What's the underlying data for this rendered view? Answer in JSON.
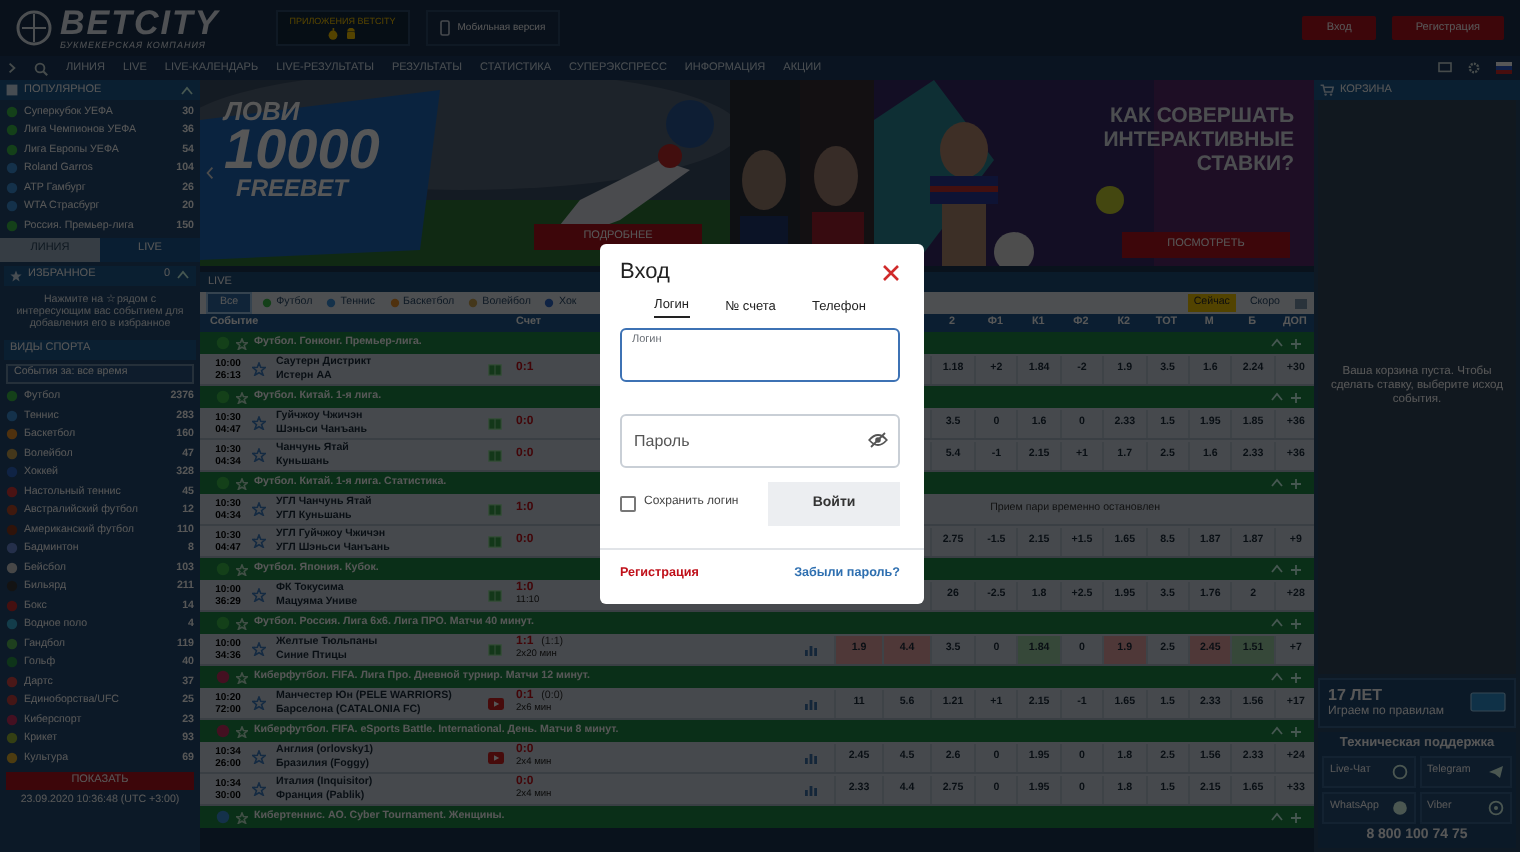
{
  "header": {
    "logo": "BETCITY",
    "logo_tagline": "БУКМЕКЕРСКАЯ КОМПАНИЯ",
    "apps_label": "ПРИЛОЖЕНИЯ BETCITY",
    "mobile_label": "Мобильная версия",
    "buttons": [
      "Вход",
      "Регистрация"
    ]
  },
  "nav": {
    "items": [
      "ЛИНИЯ",
      "LIVE",
      "LIVE-КАЛЕНДАРЬ",
      "LIVE-РЕЗУЛЬТАТЫ",
      "РЕЗУЛЬТАТЫ",
      "СТАТИСТИКА",
      "СУПЕРЭКСПРЕСС",
      "ИНФОРМАЦИЯ",
      "АКЦИИ"
    ]
  },
  "left_sidebar": {
    "popular": {
      "title": "ПОПУЛЯРНОЕ",
      "items": [
        {
          "name": "Суперкубок УЕФА",
          "count": "30",
          "kind": "football"
        },
        {
          "name": "Лига Чемпионов УЕФА",
          "count": "36",
          "kind": "football"
        },
        {
          "name": "Лига Европы УЕФА",
          "count": "54",
          "kind": "football"
        },
        {
          "name": "Roland Garros",
          "count": "104",
          "kind": "tennis"
        },
        {
          "name": "ATP Гамбург",
          "count": "26",
          "kind": "tennis"
        },
        {
          "name": "WTA Страсбург",
          "count": "20",
          "kind": "tennis"
        },
        {
          "name": "Россия. Премьер-лига",
          "count": "150",
          "kind": "football"
        }
      ]
    },
    "mode_tabs": [
      {
        "label": "ЛИНИЯ",
        "selected": false
      },
      {
        "label": "LIVE",
        "selected": true
      }
    ],
    "favorites": {
      "title": "ИЗБРАННОЕ",
      "count": "0",
      "hint": "Нажмите на ☆ рядом с интересующим вас событием для добавления его в избранное"
    },
    "sports": {
      "title": "ВИДЫ СПОРТА",
      "filter": "События за: все время",
      "items": [
        {
          "name": "Футбол",
          "count": "2376",
          "kind": "football"
        },
        {
          "name": "Теннис",
          "count": "283",
          "kind": "tennis"
        },
        {
          "name": "Баскетбол",
          "count": "160",
          "kind": "basketball"
        },
        {
          "name": "Волейбол",
          "count": "47",
          "kind": "volleyball"
        },
        {
          "name": "Хоккей",
          "count": "328",
          "kind": "hockey"
        },
        {
          "name": "Настольный теннис",
          "count": "45",
          "kind": "tabletennis"
        },
        {
          "name": "Австралийский футбол",
          "count": "12",
          "kind": "aussie"
        },
        {
          "name": "Американский футбол",
          "count": "110",
          "kind": "american"
        },
        {
          "name": "Бадминтон",
          "count": "8",
          "kind": "badminton"
        },
        {
          "name": "Бейсбол",
          "count": "103",
          "kind": "baseball"
        },
        {
          "name": "Бильярд",
          "count": "211",
          "kind": "billiards"
        },
        {
          "name": "Бокс",
          "count": "14",
          "kind": "boxing"
        },
        {
          "name": "Водное поло",
          "count": "4",
          "kind": "waterpolo"
        },
        {
          "name": "Гандбол",
          "count": "119",
          "kind": "handball"
        },
        {
          "name": "Гольф",
          "count": "40",
          "kind": "golf"
        },
        {
          "name": "Дартс",
          "count": "37",
          "kind": "darts"
        },
        {
          "name": "Единоборства/UFC",
          "count": "25",
          "kind": "mma"
        },
        {
          "name": "Киберспорт",
          "count": "23",
          "kind": "esports"
        },
        {
          "name": "Крикет",
          "count": "93",
          "kind": "cricket"
        },
        {
          "name": "Культура",
          "count": "69",
          "kind": "culture"
        }
      ]
    },
    "show_button": "ПОКАЗАТЬ",
    "datetime": "23.09.2020 10:36:48 (UTC +3:00)"
  },
  "banners": [
    {
      "kind": "freebet",
      "headline": [
        "ЛОВИ",
        "10000",
        "FREEBET"
      ],
      "button": "ПОДРОБНЕЕ"
    },
    {
      "kind": "interactive",
      "headline": [
        "КАК СОВЕРШАТЬ",
        "ИНТЕРАКТИВНЫЕ",
        "СТАВКИ?"
      ],
      "button": "ПОСМОТРЕТЬ"
    }
  ],
  "live": {
    "title": "LIVE",
    "sport_tabs": [
      {
        "label": "Все",
        "selected": true
      },
      {
        "label": "Футбол",
        "kind": "football",
        "selected": false
      },
      {
        "label": "Теннис",
        "kind": "tennis",
        "selected": false
      },
      {
        "label": "Баскетбол",
        "kind": "basketball",
        "selected": false
      },
      {
        "label": "Волейбол",
        "kind": "volleyball",
        "selected": false
      },
      {
        "label": "Хок",
        "kind": "hockey",
        "selected": false
      }
    ],
    "time_tabs": [
      {
        "label": "Сейчас",
        "selected": true
      },
      {
        "label": "Скоро",
        "selected": false
      }
    ],
    "columns": [
      "Событие",
      "Счет",
      "2",
      "Ф1",
      "К1",
      "Ф2",
      "К2",
      "ТОТ",
      "М",
      "Б",
      "ДОП"
    ],
    "groups": [
      {
        "kind": "football",
        "title": "Футбол. Гонконг. Премьер-лига.",
        "matches": [
          {
            "time": "10:00",
            "elapsed": "26:13",
            "teams": [
              "Саутерн Дистрикт",
              "Истерн АА"
            ],
            "kind": "field",
            "score": "0:1",
            "odds": [
              "1.18",
              "+2",
              "1.84",
              "-2",
              "1.9",
              "3.5",
              "1.6",
              "2.24",
              "+30"
            ]
          }
        ]
      },
      {
        "kind": "football",
        "title": "Футбол. Китай. 1-я лига.",
        "matches": [
          {
            "time": "10:30",
            "elapsed": "04:47",
            "teams": [
              "Гуйчжоу Чжичэн",
              "Шэньси Чанъань"
            ],
            "kind": "field",
            "score": "0:0",
            "odds": [
              "3.5",
              "0",
              "1.6",
              "0",
              "2.33",
              "1.5",
              "1.95",
              "1.85",
              "+36"
            ]
          },
          {
            "time": "10:30",
            "elapsed": "04:34",
            "teams": [
              "Чанчунь Ятай",
              "Куньшань"
            ],
            "kind": "field",
            "score": "0:0",
            "odds": [
              "5.4",
              "-1",
              "2.15",
              "+1",
              "1.7",
              "2.5",
              "1.6",
              "2.33",
              "+36"
            ]
          }
        ]
      },
      {
        "kind": "football",
        "title": "Футбол. Китай. 1-я лига. Статистика.",
        "matches": [
          {
            "time": "10:30",
            "elapsed": "04:34",
            "teams": [
              "УГЛ Чанчунь Ятай",
              "УГЛ Куньшань"
            ],
            "kind": "field",
            "score": "1:0",
            "suspended": "Прием пари временно остановлен"
          },
          {
            "time": "10:30",
            "elapsed": "04:47",
            "teams": [
              "УГЛ Гуйчжоу Чжичэн",
              "УГЛ Шэньси Чанъань"
            ],
            "kind": "field",
            "score": "0:0",
            "odds": [
              "2.75",
              "-1.5",
              "2.15",
              "+1.5",
              "1.65",
              "8.5",
              "1.87",
              "1.87",
              "+9"
            ]
          }
        ]
      },
      {
        "kind": "football",
        "title": "Футбол. Япония. Кубок.",
        "matches": [
          {
            "time": "10:00",
            "elapsed": "36:29",
            "teams": [
              "ФК Токусима",
              "Мацуяма Униве"
            ],
            "kind": "field",
            "score": "1:0",
            "sub": "11:10",
            "odds": [
              "26",
              "-2.5",
              "1.8",
              "+2.5",
              "1.95",
              "3.5",
              "1.76",
              "2",
              "+28"
            ]
          }
        ]
      },
      {
        "kind": "football",
        "title": "Футбол. Россия. Лига 6х6. Лига ПРО. Матчи 40 минут.",
        "matches": [
          {
            "time": "10:00",
            "elapsed": "34:36",
            "teams": [
              "Желтые Тюльпаны",
              "Синие Птицы"
            ],
            "kind": "field",
            "stats": true,
            "score": "1:1",
            "score_detail": "(1:1)",
            "sub": "2x20 мин",
            "main_odds": [
              {
                "v": "1.9",
                "falling": true
              },
              {
                "v": "4.4",
                "falling": true
              }
            ],
            "odds": [
              "3.5",
              "0",
              {
                "v": "1.84",
                "rising": true
              },
              "0",
              {
                "v": "1.9",
                "falling": true
              },
              "2.5",
              {
                "v": "2.45",
                "falling": true
              },
              {
                "v": "1.51",
                "rising": true
              },
              "+7"
            ]
          }
        ]
      },
      {
        "kind": "esports",
        "title": "Киберфутбол. FIFA. Лига Про. Дневной турнир. Матчи 12 минут.",
        "matches": [
          {
            "time": "10:20",
            "elapsed": "72:00",
            "teams": [
              "Манчестер Юн (PELE WARRIORS)",
              "Барселона (CATALONIA FC)"
            ],
            "kind": "video",
            "stats": true,
            "score": "0:1",
            "score_detail": "(0:0)",
            "sub": "2x6 мин",
            "main_odds": [
              "11",
              "5.6"
            ],
            "odds": [
              "1.21",
              "+1",
              "2.15",
              "-1",
              "1.65",
              "1.5",
              "2.33",
              "1.56",
              "+17"
            ]
          }
        ]
      },
      {
        "kind": "esports",
        "title": "Киберфутбол. FIFA. eSports Battle. International. День. Матчи 8 минут.",
        "matches": [
          {
            "time": "10:34",
            "elapsed": "26:00",
            "teams": [
              "Англия (orlovsky1)",
              "Бразилия (Foggy)"
            ],
            "kind": "video",
            "stats": true,
            "score": "0:0",
            "sub": "2x4 мин",
            "main_odds": [
              "2.45",
              "4.5"
            ],
            "odds": [
              "2.6",
              "0",
              "1.95",
              "0",
              "1.8",
              "2.5",
              "1.56",
              "2.33",
              "+24"
            ]
          },
          {
            "time": "10:34",
            "elapsed": "30:00",
            "teams": [
              "Италия (Inquisitor)",
              "Франция (Pablik)"
            ],
            "stats": true,
            "score": "0:0",
            "sub": "2x4 мин",
            "main_odds": [
              "2.33",
              "4.4"
            ],
            "odds": [
              "2.75",
              "0",
              "1.95",
              "0",
              "1.8",
              "1.5",
              "2.15",
              "1.65",
              "+33"
            ]
          }
        ]
      },
      {
        "kind": "tennis",
        "title": "Кибертеннис. АО. Cyber Tournament. Женщины."
      }
    ]
  },
  "cart": {
    "title": "КОРЗИНА",
    "empty_text": "Ваша корзина пуста. Чтобы сделать ставку, выберите исход события."
  },
  "promo": {
    "title": "17 ЛЕТ",
    "subtitle": "Играем по правилам"
  },
  "support": {
    "title": "Техническая поддержка",
    "channels": [
      {
        "label": "Live-Чат",
        "kind": "chat"
      },
      {
        "label": "Telegram",
        "kind": "telegram"
      },
      {
        "label": "WhatsApp",
        "kind": "whatsapp"
      },
      {
        "label": "Viber",
        "kind": "viber"
      }
    ],
    "phone": "8 800 100 74 75"
  },
  "login_modal": {
    "title": "Вход",
    "tabs": [
      {
        "label": "Логин",
        "selected": true
      },
      {
        "label": "№ счета",
        "selected": false
      },
      {
        "label": "Телефон",
        "selected": false
      }
    ],
    "login_field": {
      "label": "Логин",
      "focused": true
    },
    "password_field": {
      "placeholder": "Пароль"
    },
    "remember": {
      "label": "Сохранить логин",
      "checked": false
    },
    "submit": "Войти",
    "register_link": "Регистрация",
    "forgot_link": "Забыли пароль?"
  }
}
